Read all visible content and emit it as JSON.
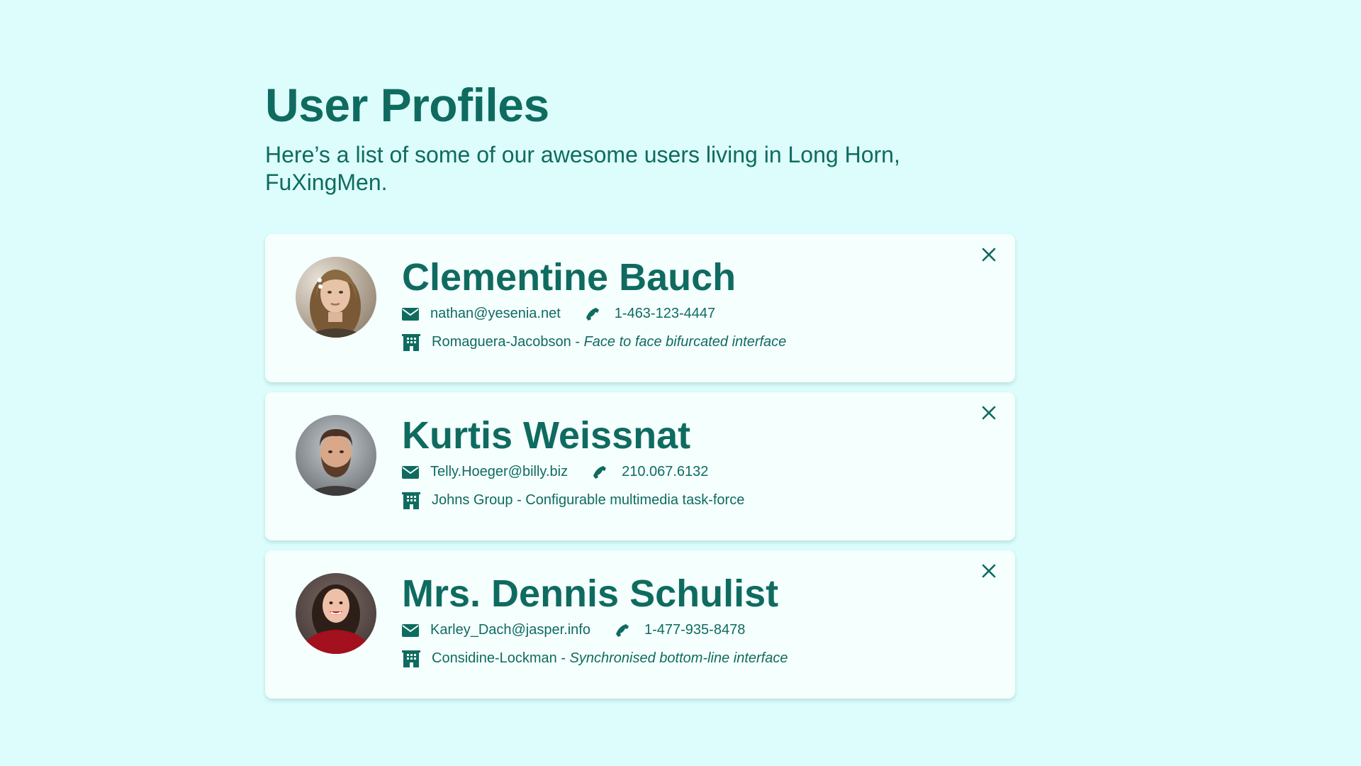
{
  "page": {
    "title": "User Profiles",
    "subtitle": "Here’s a list of some of our awesome users living in Long Horn, FuXingMen."
  },
  "colors": {
    "background": "#dcfdfc",
    "card": "#f5fffe",
    "accent": "#0f6b60"
  },
  "users": [
    {
      "name": "Clementine Bauch",
      "email": "nathan@yesenia.net",
      "phone": "1-463-123-4447",
      "company": "Romaguera-Jacobson",
      "separator": " - ",
      "catchphrase": "Face to face bifurcated interface",
      "catchphrase_italic": true,
      "avatar": "woman-blonde-portrait"
    },
    {
      "name": "Kurtis Weissnat",
      "email": "Telly.Hoeger@billy.biz",
      "phone": "210.067.6132",
      "company": "Johns Group",
      "separator": " - ",
      "catchphrase": "Configurable multimedia task-force",
      "catchphrase_italic": false,
      "avatar": "man-beard-portrait"
    },
    {
      "name": "Mrs. Dennis Schulist",
      "email": "Karley_Dach@jasper.info",
      "phone": "1-477-935-8478",
      "company": "Considine-Lockman",
      "separator": " - ",
      "catchphrase": "Synchronised bottom-line interface",
      "catchphrase_italic": true,
      "avatar": "woman-red-top-portrait"
    }
  ],
  "icons": {
    "email": "envelope-icon",
    "phone": "phone-icon",
    "company": "building-icon",
    "close": "close-icon"
  }
}
